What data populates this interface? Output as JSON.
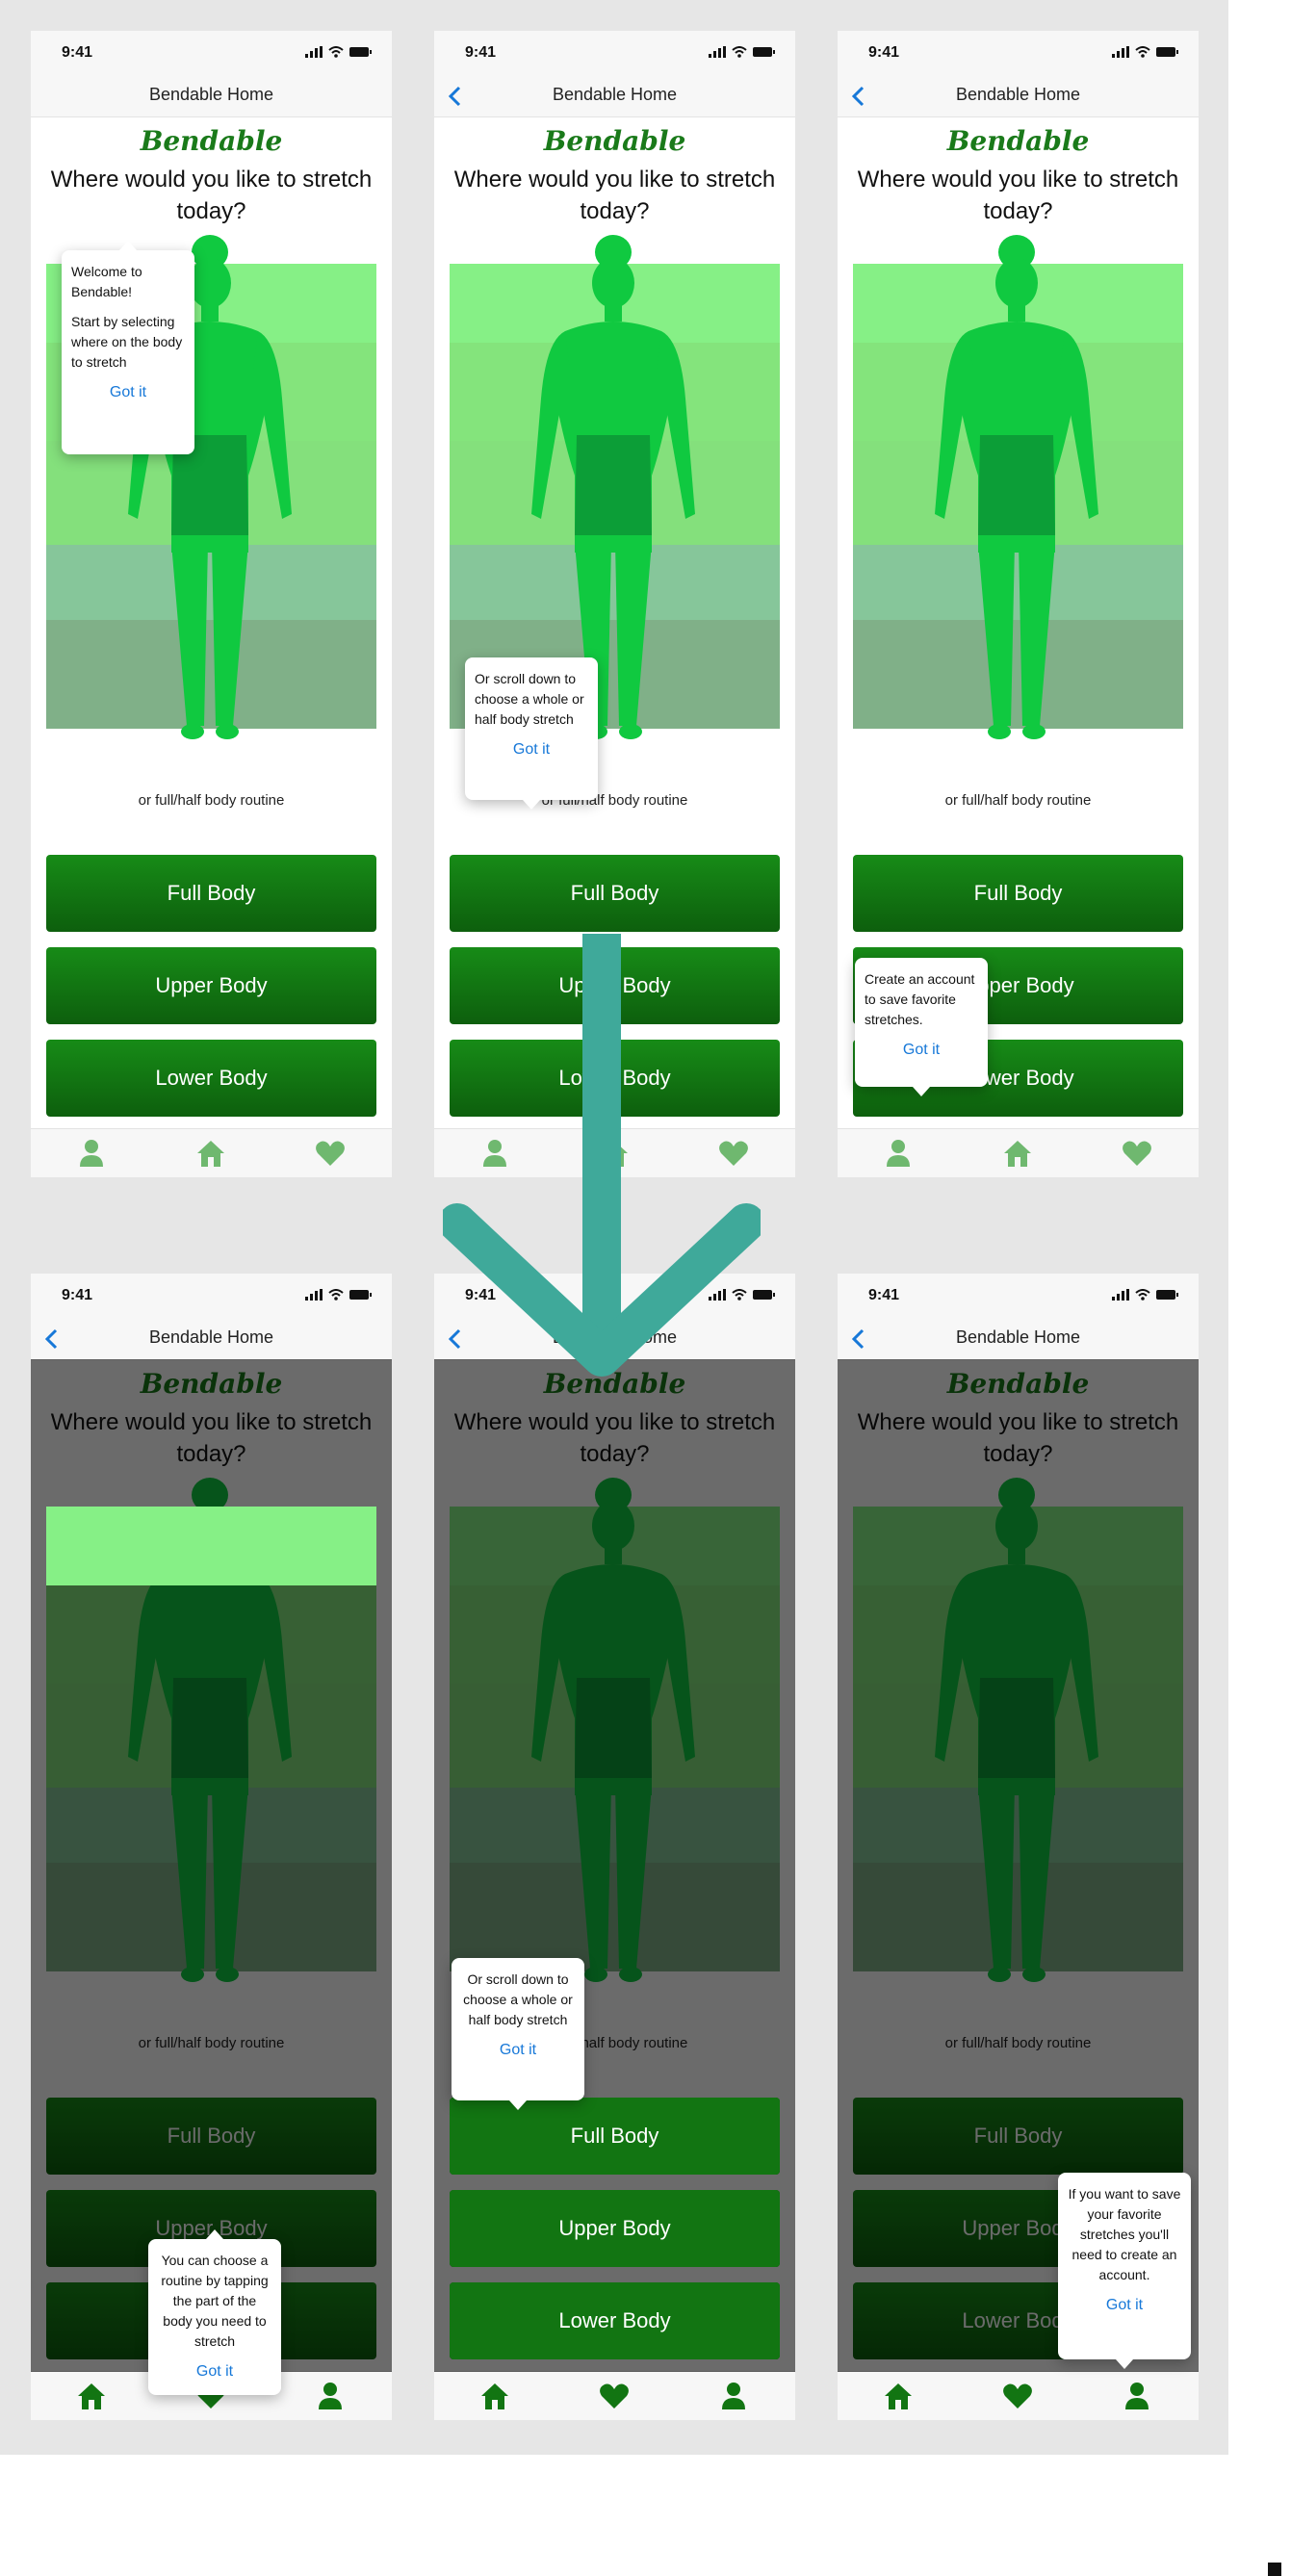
{
  "screens": [
    {
      "time": "9:41",
      "title": "Bendable Home",
      "logo": "Bendable",
      "headline": "Where would you like to stretch today?",
      "routine_text": "or  full/half body routine",
      "buttons": [
        "Full Body",
        "Upper Body",
        "Lower Body"
      ],
      "tooltip": {
        "lines": [
          "Welcome to Bendable!",
          "Start  by selecting where on the body to stretch"
        ],
        "action": "Got it"
      },
      "tabs": [
        "person-icon",
        "home-icon",
        "heart-icon"
      ]
    },
    {
      "time": "9:41",
      "title": "Bendable Home",
      "logo": "Bendable",
      "headline": "Where would you like to stretch today?",
      "routine_text": "or  full/half body routine",
      "buttons": [
        "Full Body",
        "Upper Body",
        "Lower Body"
      ],
      "tooltip": {
        "lines": [
          "Or scroll down to choose a whole or half body stretch"
        ],
        "action": "Got it"
      },
      "tabs": [
        "person-icon",
        "home-icon",
        "heart-icon"
      ]
    },
    {
      "time": "9:41",
      "title": "Bendable Home",
      "logo": "Bendable",
      "headline": "Where would you like to stretch today?",
      "routine_text": "or  full/half body routine",
      "buttons": [
        "Full Body",
        "Upper Body",
        "Lower Body"
      ],
      "tooltip": {
        "lines": [
          "Create an account to save favorite stretches."
        ],
        "action": "Got it"
      },
      "tabs": [
        "person-icon",
        "home-icon",
        "heart-icon"
      ]
    },
    {
      "time": "9:41",
      "title": "Bendable Home",
      "logo": "Bendable",
      "headline": "Where would you like to stretch today?",
      "routine_text": "or  full/half body routine",
      "buttons": [
        "Full Body",
        "Upper Body",
        "Lower Body"
      ],
      "tooltip": {
        "lines": [
          "You can choose a routine  by tapping the part of the body you need to stretch"
        ],
        "action": "Got it"
      },
      "tabs": [
        "home-icon",
        "heart-icon",
        "person-icon"
      ]
    },
    {
      "time": "9:41",
      "title": "Bendable Home",
      "logo": "Bendable",
      "headline": "Where would you like to stretch today?",
      "routine_text": "or  full/half body routine",
      "buttons": [
        "Full Body",
        "Upper Body",
        "Lower Body"
      ],
      "tooltip": {
        "lines": [
          "Or scroll down to choose a whole or half body stretch"
        ],
        "action": "Got it"
      },
      "tabs": [
        "home-icon",
        "heart-icon",
        "person-icon"
      ]
    },
    {
      "time": "9:41",
      "title": "Bendable Home",
      "logo": "Bendable",
      "headline": "Where would you like to stretch today?",
      "routine_text": "or  full/half body routine",
      "buttons": [
        "Full Body",
        "Upper Body",
        "Lower Body"
      ],
      "tooltip": {
        "lines": [
          "If you want to save your favorite stretches you'll need to create an account."
        ],
        "action": "Got it"
      },
      "tabs": [
        "home-icon",
        "heart-icon",
        "person-icon"
      ]
    }
  ],
  "colors": {
    "band_head": "#86f086",
    "band_chest": "#84e47c",
    "band_hips": "#84e07c",
    "band_thigh": "#86c69a",
    "band_legs": "#80b088",
    "figure": "#10c940",
    "button": "#127512",
    "link": "#1778d8",
    "flow_arrow": "#3fa99a"
  }
}
